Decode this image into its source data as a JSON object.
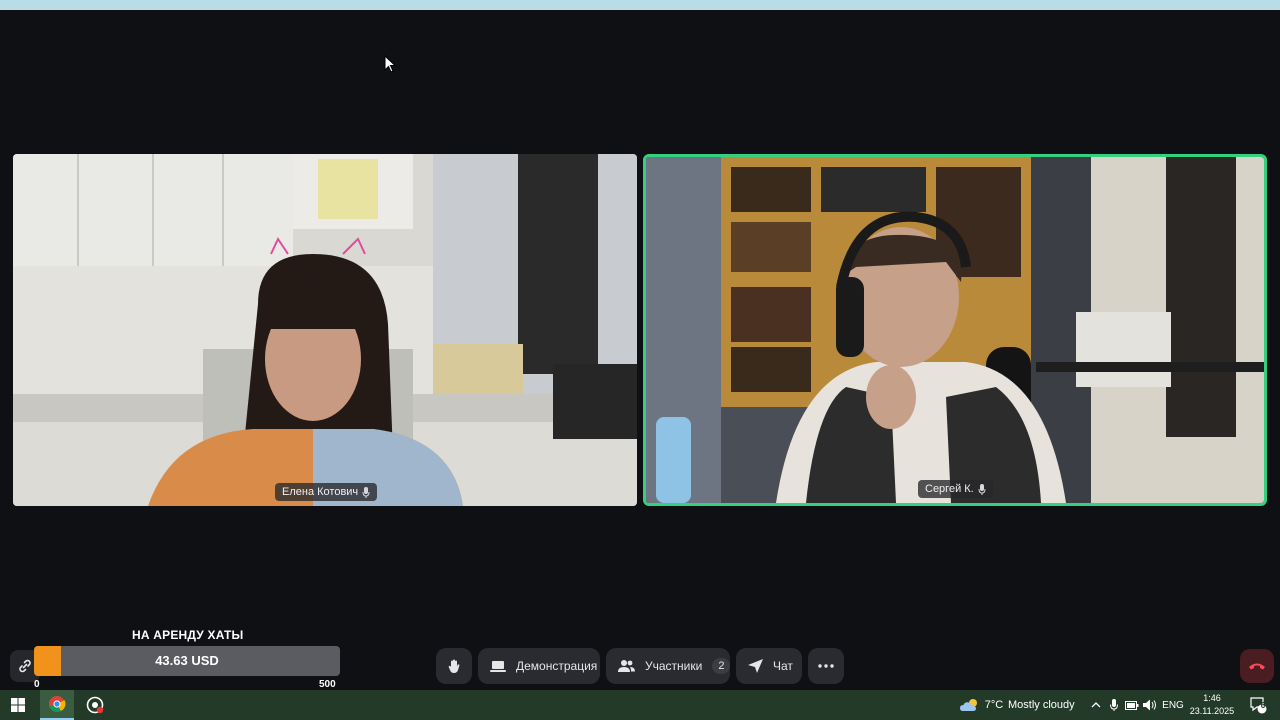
{
  "participants": [
    {
      "name": "Елена Котович"
    },
    {
      "name": "Сергей К."
    }
  ],
  "donation": {
    "title": "НА АРЕНДУ ХАТЫ",
    "amount": "43.63 USD",
    "min": "0",
    "max": "500",
    "progress_fraction": 0.0873,
    "fill_color": "#f0921b"
  },
  "controls": {
    "raise_hand_icon": "hand-icon",
    "screenshare_label": "Демонстрация",
    "participants_label": "Участники",
    "participants_count": "2",
    "chat_label": "Чат",
    "more_icon": "more-dots-icon",
    "hangup_icon": "phone-hangup-icon"
  },
  "active_speaker_color": "#35d07f",
  "taskbar": {
    "weather_temp": "7°C",
    "weather_desc": "Mostly cloudy",
    "language": "ENG",
    "time": "1:46",
    "date": "23.11.2025",
    "notifications_count": "6"
  }
}
